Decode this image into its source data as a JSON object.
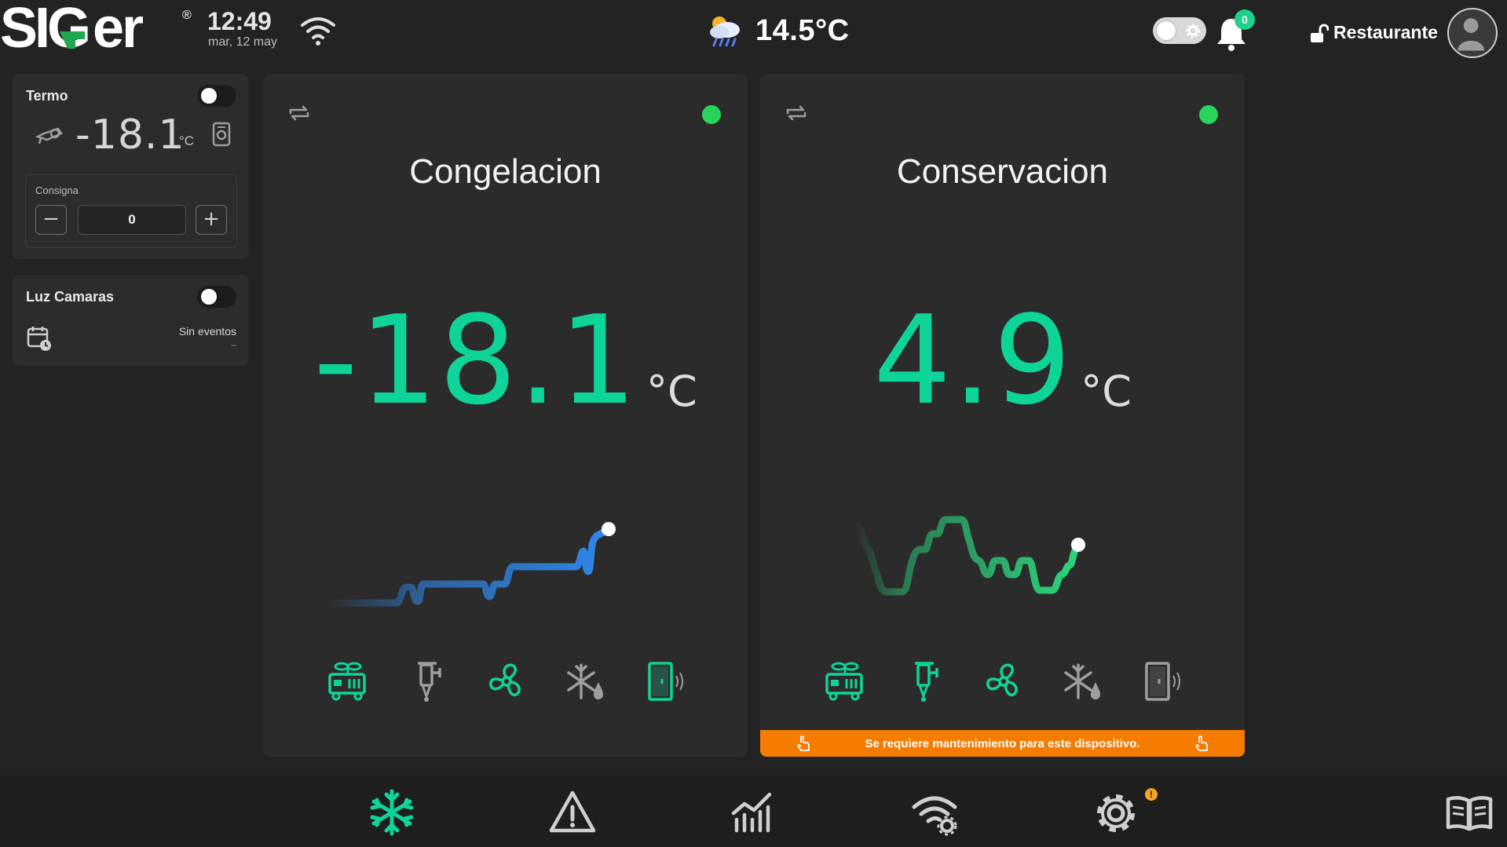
{
  "brand": {
    "name": "SIGer",
    "registered": "®",
    "accent": "#1fa84f"
  },
  "clock": {
    "time": "12:49",
    "date": "mar, 12 may"
  },
  "weather": {
    "temperature": "14.5°C",
    "icon": "cloud-sun-rain-icon"
  },
  "notifications": {
    "count": "0"
  },
  "user": {
    "name": "Restaurante"
  },
  "colors": {
    "accent": "#0fd49a",
    "ok": "#2ad35a",
    "warning": "#f57c00",
    "trend_cold": "#2f86e8",
    "trend_cons": "#2bd67e"
  },
  "termo": {
    "title": "Termo",
    "reading": "-18.1",
    "unit": "°C",
    "setpoint_label": "Consigna",
    "setpoint_value": "0",
    "minus": "−",
    "plus": "+"
  },
  "luz": {
    "title": "Luz Camaras",
    "events": "Sin eventos",
    "events_sub": "–"
  },
  "panels": [
    {
      "title": "Congelacion",
      "temperature": "-18.1",
      "unit": "°C",
      "status": "online",
      "icons": [
        "compressor-icon",
        "valve-icon",
        "fan-icon",
        "defrost-icon",
        "door-icon"
      ]
    },
    {
      "title": "Conservacion",
      "temperature": "4.9",
      "unit": "°C",
      "status": "online",
      "icons": [
        "compressor-icon",
        "valve-icon",
        "fan-icon",
        "defrost-icon",
        "door-icon"
      ],
      "maintenance": "Se requiere mantenimiento para este dispositivo."
    }
  ],
  "nav": {
    "items": [
      "snowflake-icon",
      "alert-icon",
      "chart-icon",
      "wifi-settings-icon",
      "settings-icon",
      "manual-icon"
    ],
    "settings_badge": "!"
  }
}
